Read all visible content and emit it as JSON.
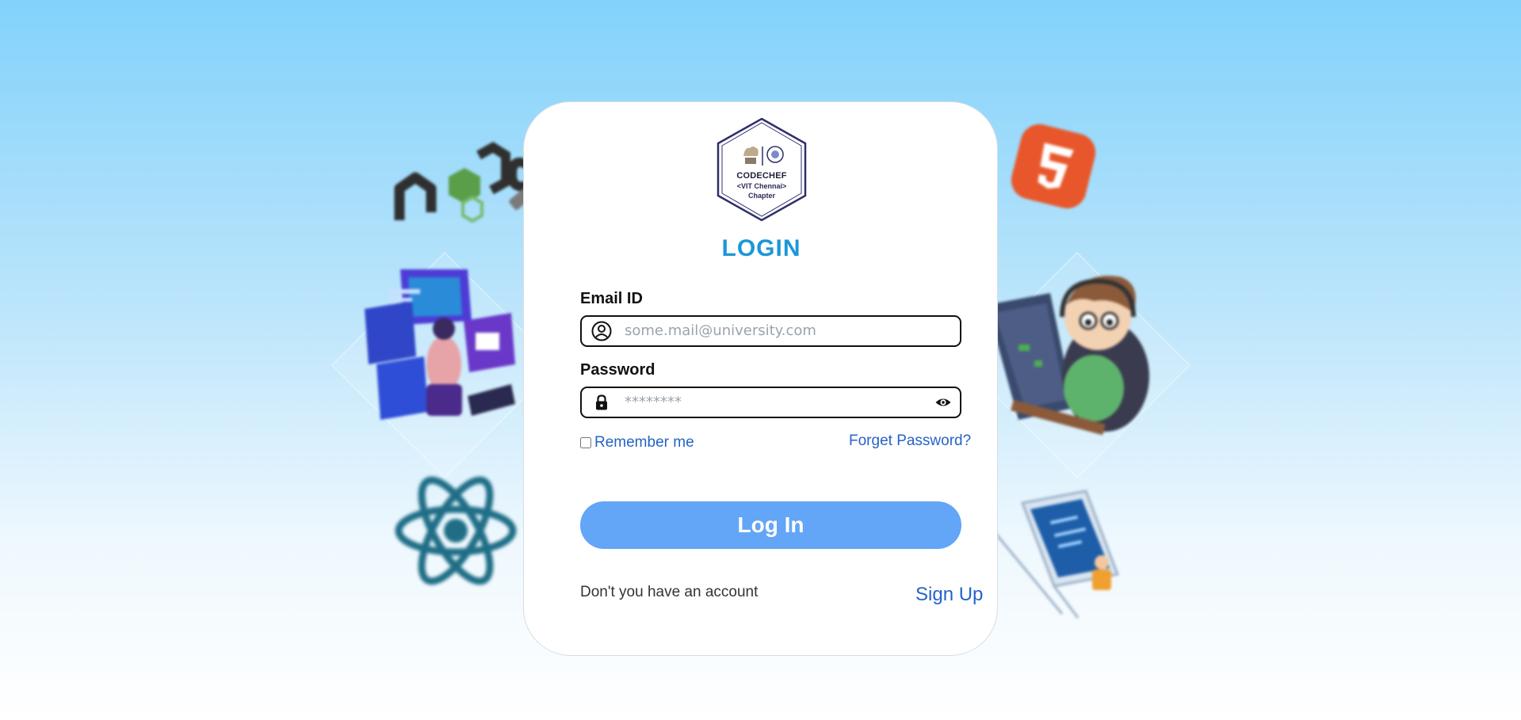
{
  "logo": {
    "line1": "CODECHEF",
    "line2": "<VIT Chennai>",
    "line3": "Chapter"
  },
  "title": "LOGIN",
  "email": {
    "label": "Email ID",
    "placeholder": "some.mail@university.com",
    "value": ""
  },
  "password": {
    "label": "Password",
    "placeholder": "********",
    "value": ""
  },
  "remember": {
    "label": "Remember me",
    "checked": false
  },
  "forget_password": "Forget Password?",
  "login_button": "Log In",
  "signup": {
    "prompt": "Don't you have an account",
    "link": "Sign Up"
  },
  "colors": {
    "title": "#1b97d8",
    "link": "#2563c9",
    "button": "#63a5f6",
    "background_top": "#82d2fb"
  },
  "decorations": [
    "nodejs-logo",
    "html5-logo",
    "developer-illustration",
    "coder-boy-illustration",
    "react-logo",
    "laptop-illustration"
  ]
}
